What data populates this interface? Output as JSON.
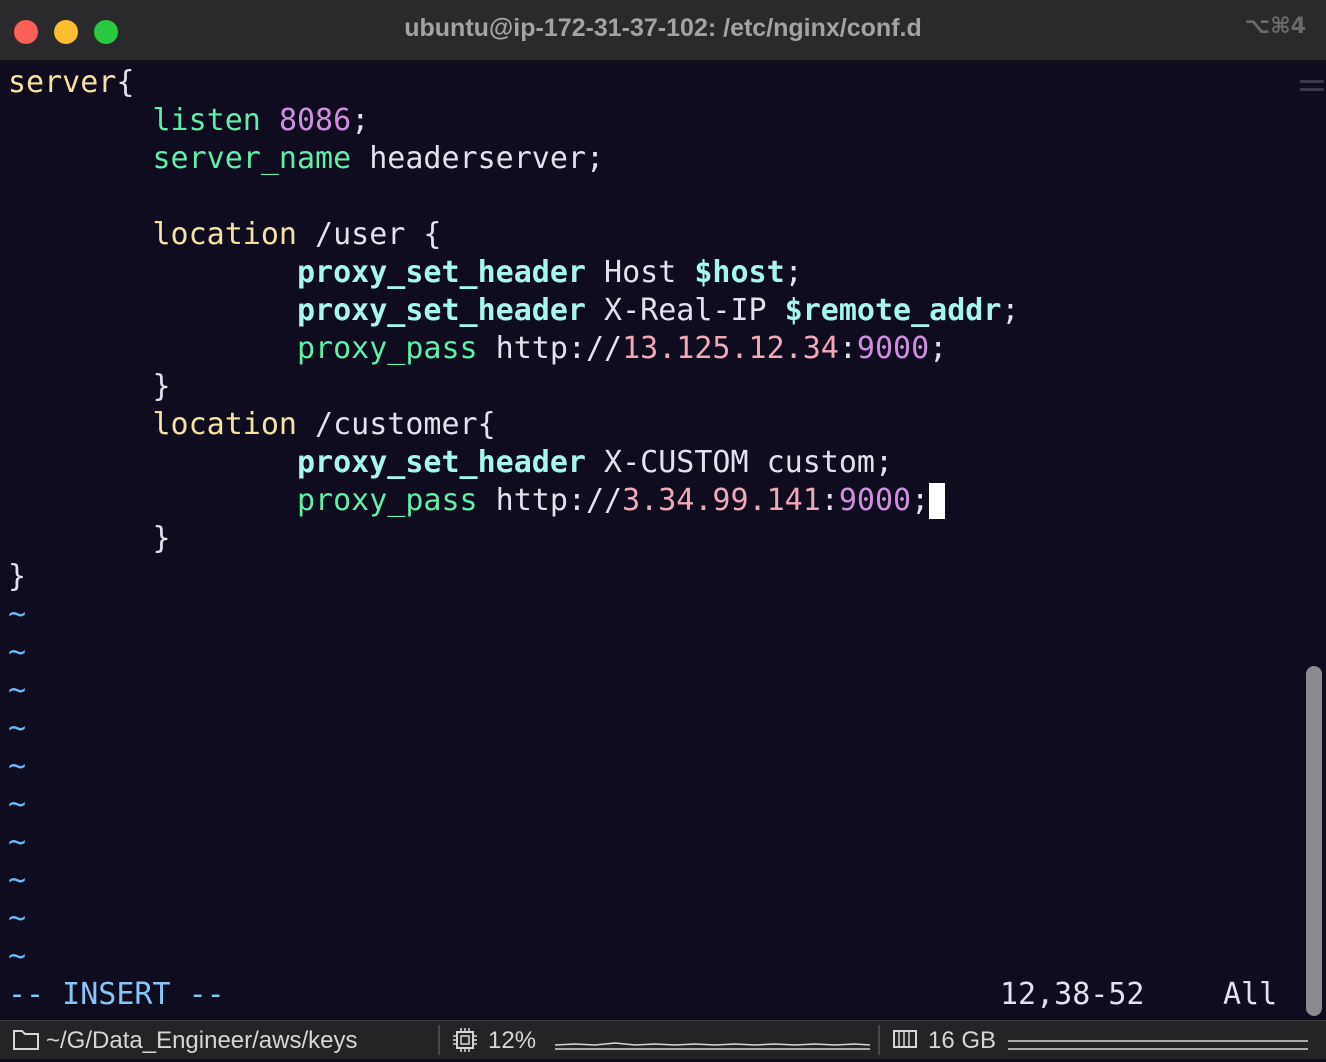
{
  "window": {
    "title": "ubuntu@ip-172-31-37-102: /etc/nginx/conf.d",
    "shortcut": "⌥⌘4"
  },
  "editor": {
    "lines": {
      "l1": {
        "server": "server",
        "brace": "{"
      },
      "l2": {
        "indent": "        ",
        "directive": "listen",
        "sp": " ",
        "port": "8086",
        "semi": ";"
      },
      "l3": {
        "indent": "        ",
        "directive": "server_name",
        "rest": " headerserver;"
      },
      "l5": {
        "indent": "        ",
        "keyword": "location",
        "rest": " /user {"
      },
      "l6": {
        "indent": "                ",
        "directive": "proxy_set_header",
        "rest": " Host ",
        "var": "$host",
        "semi": ";"
      },
      "l7": {
        "indent": "                ",
        "directive": "proxy_set_header",
        "rest": " X-Real-IP ",
        "var": "$remote_addr",
        "semi": ";"
      },
      "l8": {
        "indent": "                ",
        "directive": "proxy_pass",
        "scheme": " http://",
        "ip": "13.125.12.34",
        "colon": ":",
        "port": "9000",
        "semi": ";"
      },
      "l9": {
        "indent": "        ",
        "brace": "}"
      },
      "l10": {
        "indent": "        ",
        "keyword": "location",
        "rest": " /customer{"
      },
      "l11": {
        "indent": "                ",
        "directive": "proxy_set_header",
        "rest": " X-CUSTOM custom;"
      },
      "l12": {
        "indent": "                ",
        "directive": "proxy_pass",
        "scheme": " http://",
        "ip": "3.34.99.141",
        "colon": ":",
        "port": "9000",
        "semi": ";"
      },
      "l13": {
        "indent": "        ",
        "brace": "}"
      },
      "l14": {
        "brace": "}"
      }
    },
    "tilde": "~",
    "mode": "-- INSERT --",
    "cursor_position": "12,38-52",
    "scroll_position": "All"
  },
  "statusbar": {
    "path": "~/G/Data_Engineer/aws/keys",
    "cpu": "12%",
    "memory": "16 GB"
  },
  "icons": {
    "folder": "folder-icon",
    "cpu": "cpu-chip-icon",
    "memory": "memory-icon"
  },
  "colors": {
    "background": "#0f0c20",
    "keyword": "#f7e3a0",
    "directive": "#5ef0a6",
    "variable": "#a6f7ee",
    "number": "#d08ee0",
    "ip": "#f2a8b6",
    "tilde": "#6fb7f7"
  }
}
